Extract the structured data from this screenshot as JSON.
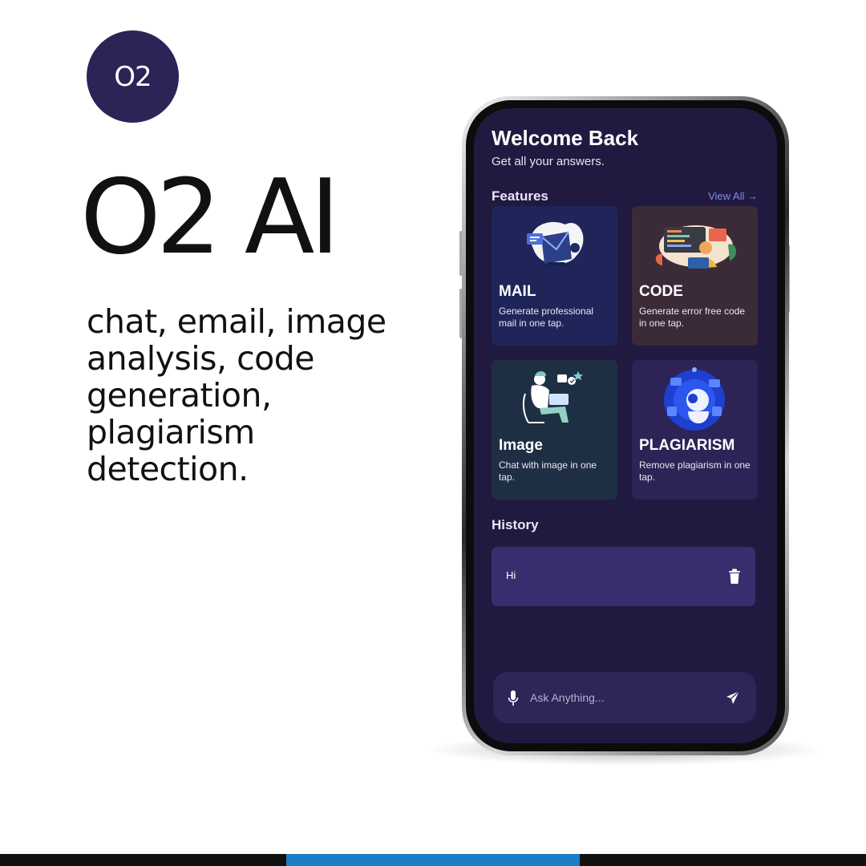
{
  "badge": {
    "label": "O2"
  },
  "brand": {
    "title": "O2 AI"
  },
  "tagline": "chat, email, image analysis, code generation, plagiarism detection.",
  "app": {
    "welcome_title": "Welcome Back",
    "welcome_subtitle": "Get all your answers.",
    "features_heading": "Features",
    "view_all_label": "View All →",
    "features": [
      {
        "title": "MAIL",
        "description": "Generate professional mail in one tap.",
        "icon": "mail-illustration"
      },
      {
        "title": "CODE",
        "description": "Generate error free code in one tap.",
        "icon": "code-illustration"
      },
      {
        "title": "Image",
        "description": "Chat with image in one tap.",
        "icon": "image-chat-illustration"
      },
      {
        "title": "PLAGIARISM",
        "description": "Remove plagiarism in one tap.",
        "icon": "robot-illustration"
      }
    ],
    "history_heading": "History",
    "history": [
      {
        "text": "Hi"
      }
    ],
    "ask_placeholder": "Ask Anything..."
  },
  "colors": {
    "badge_bg": "#2c2356",
    "screen_bg": "#201a40",
    "accent_link": "#7f8cf0",
    "history_item_bg": "#3a2d6d",
    "bottom_bar_accent": "#1b7fc6"
  }
}
